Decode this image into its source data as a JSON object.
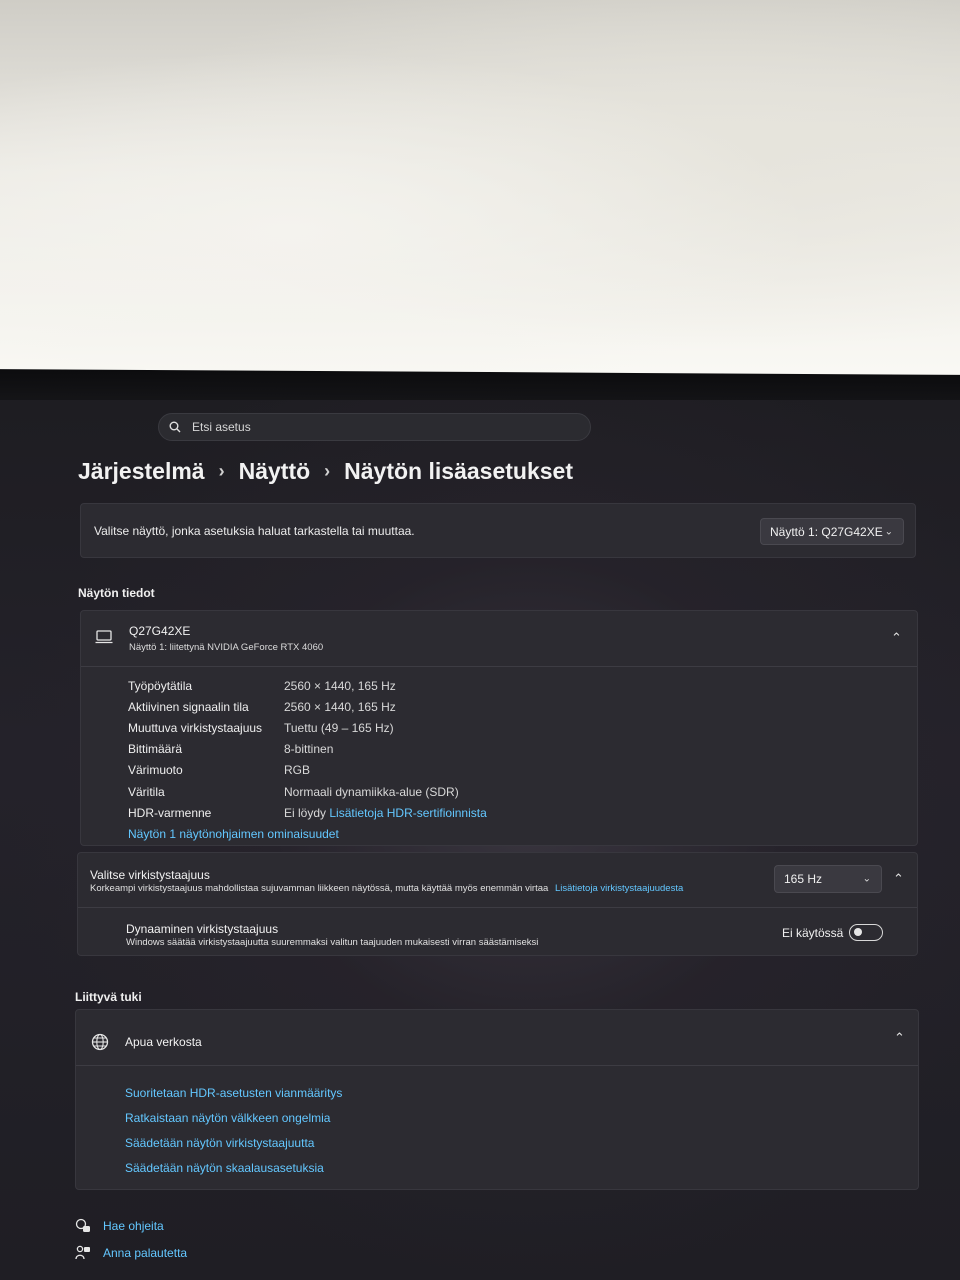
{
  "search": {
    "placeholder": "Etsi asetus"
  },
  "breadcrumb": {
    "level1": "Järjestelmä",
    "level2": "Näyttö",
    "level3": "Näytön lisäasetukset"
  },
  "select_display": {
    "prompt": "Valitse näyttö, jonka asetuksia haluat tarkastella tai muuttaa.",
    "selected": "Näyttö 1: Q27G42XE"
  },
  "display_info": {
    "section_title": "Näytön tiedot",
    "monitor_name": "Q27G42XE",
    "monitor_sub": "Näyttö 1: liitettynä NVIDIA GeForce RTX 4060",
    "rows": [
      {
        "label": "Työpöytätila",
        "value": "2560 × 1440, 165 Hz"
      },
      {
        "label": "Aktiivinen signaalin tila",
        "value": "2560 × 1440, 165 Hz"
      },
      {
        "label": "Muuttuva virkistystaajuus",
        "value": "Tuettu (49 – 165 Hz)"
      },
      {
        "label": "Bittimäärä",
        "value": "8-bittinen"
      },
      {
        "label": "Värimuoto",
        "value": "RGB"
      },
      {
        "label": "Väritila",
        "value": "Normaali dynamiikka-alue (SDR)"
      },
      {
        "label": "HDR-varmenne",
        "value": "Ei löydy"
      }
    ],
    "hdr_link": "Lisätietoja HDR-sertifioinnista",
    "adapter_link": "Näytön 1 näytönohjaimen ominaisuudet"
  },
  "refresh": {
    "title": "Valitse virkistystaajuus",
    "description": "Korkeampi virkistystaajuus mahdollistaa sujuvamman liikkeen näytössä, mutta käyttää myös enemmän virtaa",
    "learn_more": "Lisätietoja virkistystaajuudesta",
    "selected_rate": "165 Hz",
    "dynamic_title": "Dynaaminen virkistystaajuus",
    "dynamic_description": "Windows säätää virkistystaajuutta suuremmaksi valitun taajuuden mukaisesti virran säästämiseksi",
    "dynamic_state": "Ei käytössä",
    "dynamic_enabled": false
  },
  "support": {
    "section_title": "Liittyvä tuki",
    "group_title": "Apua verkosta",
    "links": [
      "Suoritetaan HDR-asetusten vianmääritys",
      "Ratkaistaan näytön välkkeen ongelmia",
      "Säädetään näytön virkistystaajuutta",
      "Säädetään näytön skaalausasetuksia"
    ]
  },
  "footer": {
    "help": "Hae ohjeita",
    "feedback": "Anna palautetta"
  },
  "colors": {
    "accent_link": "#63c7ff",
    "panel": "#2c2b31",
    "background": "#1e1d22"
  }
}
